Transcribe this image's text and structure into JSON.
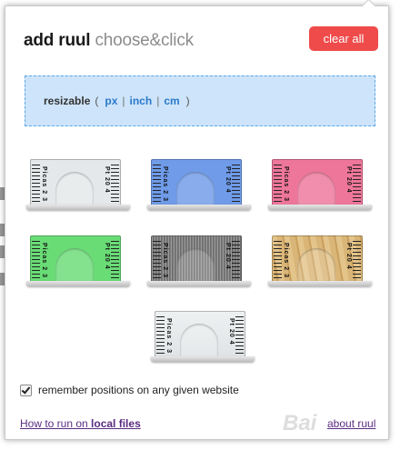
{
  "header": {
    "title_main": "add ruul",
    "title_sub": "choose&click",
    "clear_label": "clear all"
  },
  "resizable": {
    "label": "resizable",
    "open_paren": "(",
    "close_paren": ")",
    "separator": "|",
    "units": [
      "px",
      "inch",
      "cm"
    ]
  },
  "rulers": [
    {
      "color": "#e4e8ea",
      "scale_left": "Picas 2 3",
      "scale_right": "Pt 20 4"
    },
    {
      "color": "#6f9be8",
      "scale_left": "Picas 2 3",
      "scale_right": "Pt 20 4"
    },
    {
      "color": "#ee769b",
      "scale_left": "Picas 2 3",
      "scale_right": "Pt 20 4"
    },
    {
      "color": "#69dc76",
      "scale_left": "Picas 2 3",
      "scale_right": "Pt 20 4"
    },
    {
      "color": "#8a8a8a",
      "scale_left": "Picas 2 3",
      "scale_right": "Pt 20 4"
    },
    {
      "color": "#d8b176",
      "scale_left": "Picas 2 3",
      "scale_right": "Pt 20 4"
    },
    {
      "color": "#e4e8ea",
      "scale_left": "Picas 2 3",
      "scale_right": "Pt 20 4"
    }
  ],
  "remember": {
    "label": "remember positions on any given website",
    "checked": true
  },
  "footer": {
    "run_prefix": "How to run on ",
    "run_bold": "local files",
    "about": "about ruul"
  },
  "watermark": "Bai"
}
